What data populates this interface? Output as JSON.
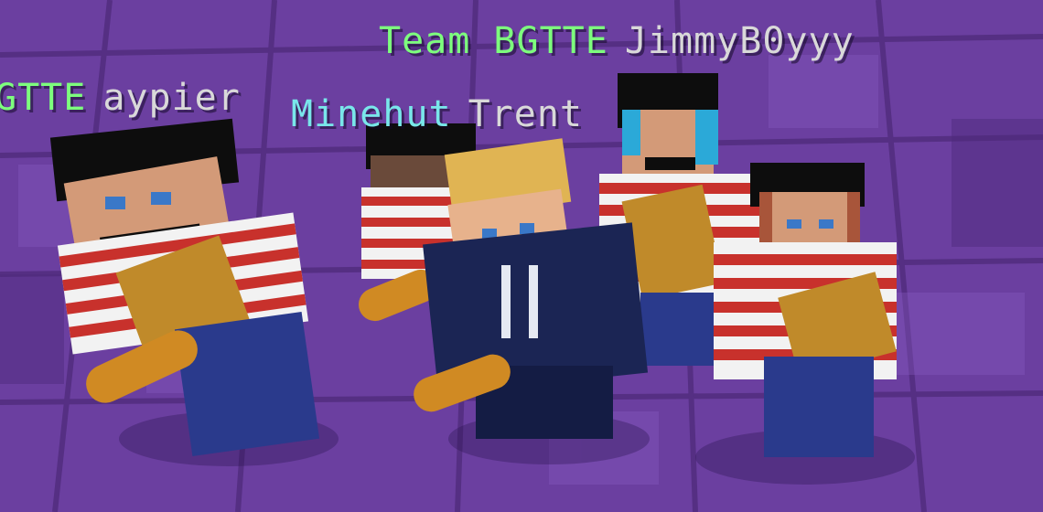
{
  "colors": {
    "floor": "#6b3fa0",
    "floor_dark": "#4e2a7a",
    "floor_light": "#8a5cc2",
    "team_green": "#7dff7d",
    "name_gray": "#d9d9d9",
    "minehut_cyan": "#79e7ea",
    "stripe_red": "#c8312c",
    "stripe_white": "#f2f2f2",
    "beret": "#0d0d0d",
    "skin": "#d39a78",
    "pants": "#2a3a8c",
    "suit": "#1b2554",
    "hair_blond": "#e0b453",
    "baguette": "#d08a23"
  },
  "nametags": [
    {
      "id": "jimmy",
      "team": "Team BGTTE",
      "name": "JimmyB0yyy"
    },
    {
      "id": "aypier",
      "team": "GTTE",
      "name": "aypier"
    },
    {
      "id": "trent",
      "team": "Minehut",
      "name": "Trent"
    }
  ],
  "players": [
    {
      "id": "left-mime",
      "skin": "french-mime",
      "held_item": "baguette"
    },
    {
      "id": "back-mime",
      "skin": "french-mime",
      "held_item": "baguette"
    },
    {
      "id": "trent",
      "skin": "blond-suit",
      "held_item": "baguette"
    },
    {
      "id": "blue-hair-mime",
      "skin": "french-mime-blue-hair",
      "held_item": "baguette"
    },
    {
      "id": "right-mime",
      "skin": "french-mime",
      "held_item": "baguette"
    }
  ]
}
